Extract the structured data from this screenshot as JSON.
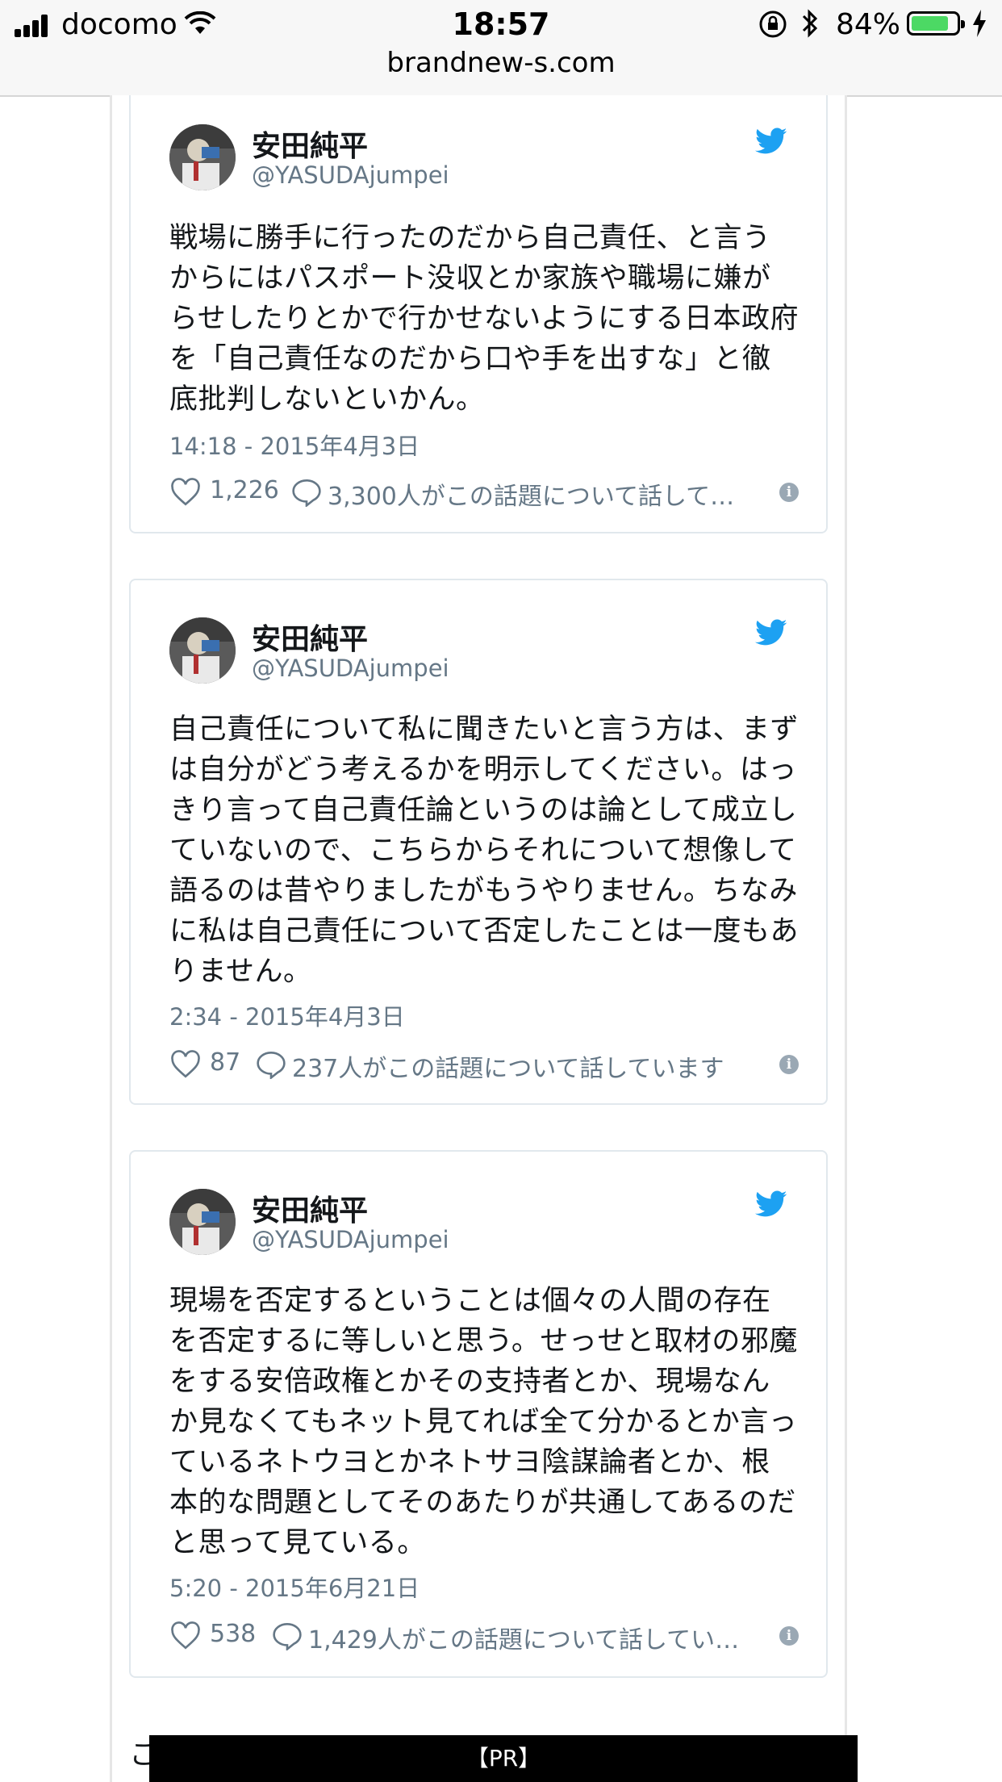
{
  "status_bar": {
    "carrier": "docomo",
    "time": "18:57",
    "battery_percent": "84%",
    "battery_level": 0.84,
    "battery_color": "#4cd964"
  },
  "browser": {
    "url": "brandnew-s.com"
  },
  "tweets": [
    {
      "author_name": "安田純平",
      "author_handle": "@YASUDAjumpei",
      "text": "戦場に勝手に行ったのだから自己責任、と言うからにはパスポート没収とか家族や職場に嫌がらせしたりとかで行かせないようにする日本政府を「自己責任なのだから口や手を出すな」と徹底批判しないといかん。",
      "timestamp": "14:18 - 2015年4月3日",
      "likes": "1,226",
      "talking": "3,300人がこの話題について話して…"
    },
    {
      "author_name": "安田純平",
      "author_handle": "@YASUDAjumpei",
      "text": "自己責任について私に聞きたいと言う方は、まずは自分がどう考えるかを明示してください。はっきり言って自己責任論というのは論として成立していないので、こちらからそれについて想像して語るのは昔やりましたがもうやりません。ちなみに私は自己責任について否定したことは一度もありません。",
      "timestamp": "2:34 - 2015年4月3日",
      "likes": "87",
      "talking": "237人がこの話題について話しています"
    },
    {
      "author_name": "安田純平",
      "author_handle": "@YASUDAjumpei",
      "text": "現場を否定するということは個々の人間の存在を否定するに等しいと思う。せっせと取材の邪魔をする安倍政権とかその支持者とか、現場なんか見なくてもネット見てれば全て分かるとか言っているネトウヨとかネトサヨ陰謀論者とか、根本的な問題としてそのあたりが共通してあるのだと思って見ている。",
      "timestamp": "5:20 - 2015年6月21日",
      "likes": "538",
      "talking": "1,429人がこの話題について話してい…"
    }
  ],
  "footer": {
    "partial_text": "こ",
    "pr_label": "【PR】"
  },
  "colors": {
    "twitter_blue": "#1da1f2",
    "secondary_text": "#657786",
    "card_border": "#e1e8ed"
  }
}
